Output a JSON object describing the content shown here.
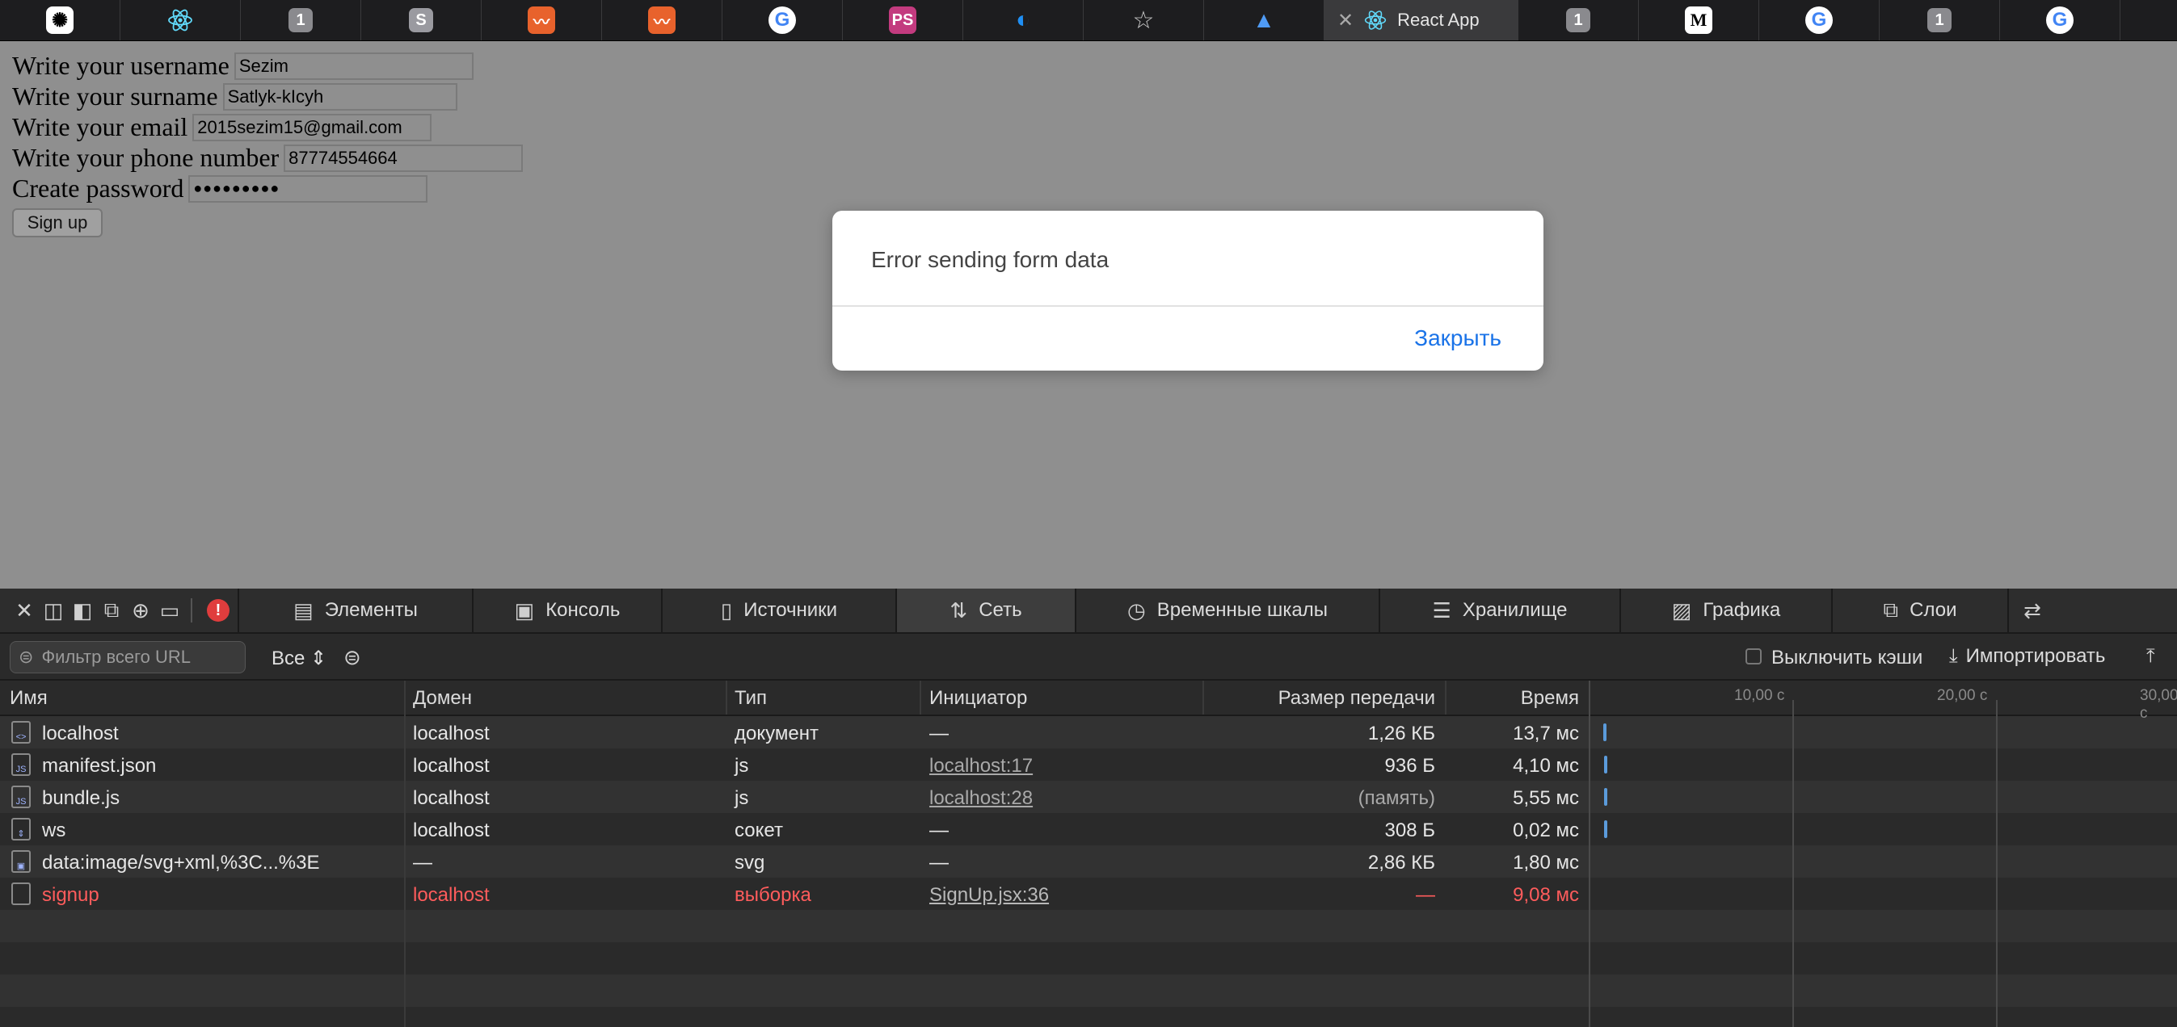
{
  "tabbar": {
    "active_tab": {
      "label": "React App"
    },
    "tabs": [
      {
        "icon": "chatgpt-icon"
      },
      {
        "icon": "react-icon"
      },
      {
        "icon": "number-one-icon",
        "text": "1"
      },
      {
        "icon": "s-letter-icon",
        "text": "S"
      },
      {
        "icon": "orange-wave-icon"
      },
      {
        "icon": "orange-wave-icon"
      },
      {
        "icon": "google-icon",
        "text": "G"
      },
      {
        "icon": "ps-icon",
        "text": "PS"
      },
      {
        "icon": "digitalocean-icon"
      },
      {
        "icon": "star-icon"
      },
      {
        "icon": "azure-icon"
      },
      {
        "icon": "react-icon",
        "active": true
      },
      {
        "icon": "number-one-icon",
        "text": "1"
      },
      {
        "icon": "medium-icon",
        "text": "M"
      },
      {
        "icon": "google-icon",
        "text": "G"
      },
      {
        "icon": "number-one-icon",
        "text": "1"
      },
      {
        "icon": "google-icon",
        "text": "G"
      }
    ]
  },
  "form": {
    "username": {
      "label": "Write your username",
      "value": "Sezim"
    },
    "surname": {
      "label": "Write your surname",
      "value": "Satlyk-kIcyh"
    },
    "email": {
      "label": "Write your email",
      "value": "2015sezim15@gmail.com"
    },
    "phone": {
      "label": "Write your phone number",
      "value": "87774554664"
    },
    "password": {
      "label": "Create password",
      "value": "●●●●●●●●●"
    },
    "submit_label": "Sign up"
  },
  "dialog": {
    "message": "Error sending form data",
    "close_label": "Закрыть"
  },
  "devtools": {
    "tabs": [
      {
        "label": "Элементы",
        "icon": "elements-icon"
      },
      {
        "label": "Консоль",
        "icon": "console-icon"
      },
      {
        "label": "Источники",
        "icon": "sources-icon"
      },
      {
        "label": "Сеть",
        "icon": "network-icon",
        "active": true
      },
      {
        "label": "Временные шкалы",
        "icon": "timelines-icon"
      },
      {
        "label": "Хранилище",
        "icon": "storage-icon"
      },
      {
        "label": "Графика",
        "icon": "graphics-icon"
      },
      {
        "label": "Слои",
        "icon": "layers-icon"
      }
    ],
    "error_badge": "!",
    "filter": {
      "placeholder": "Фильтр всего URL",
      "type_select": "Все",
      "disable_cache": "Выключить кэши",
      "import": "Импортировать"
    },
    "columns": {
      "name": "Имя",
      "domain": "Домен",
      "type": "Тип",
      "initiator": "Инициатор",
      "transfer_size": "Размер передачи",
      "time": "Время"
    },
    "timeline_ticks": [
      "10,00 с",
      "20,00 с",
      "30,00 с"
    ],
    "requests": [
      {
        "name": "localhost",
        "domain": "localhost",
        "type": "документ",
        "initiator": "—",
        "size": "1,26 КБ",
        "time": "13,7 мс",
        "icon": "document-icon",
        "error": false
      },
      {
        "name": "manifest.json",
        "domain": "localhost",
        "type": "js",
        "initiator": "localhost:17",
        "size": "936 Б",
        "time": "4,10 мс",
        "icon": "js-file-icon",
        "error": false
      },
      {
        "name": "bundle.js",
        "domain": "localhost",
        "type": "js",
        "initiator": "localhost:28",
        "size": "(память)",
        "time": "5,55 мс",
        "icon": "js-file-icon",
        "error": false
      },
      {
        "name": "ws",
        "domain": "localhost",
        "type": "сокет",
        "initiator": "—",
        "size": "308 Б",
        "time": "0,02 мс",
        "icon": "websocket-icon",
        "error": false
      },
      {
        "name": "data:image/svg+xml,%3C...%3E",
        "domain": "—",
        "type": "svg",
        "initiator": "—",
        "size": "2,86 КБ",
        "time": "1,80 мс",
        "icon": "image-file-icon",
        "error": false
      },
      {
        "name": "signup",
        "domain": "localhost",
        "type": "выборка",
        "initiator": "SignUp.jsx:36",
        "size": "—",
        "time": "9,08 мс",
        "icon": "file-icon",
        "error": true
      }
    ]
  }
}
